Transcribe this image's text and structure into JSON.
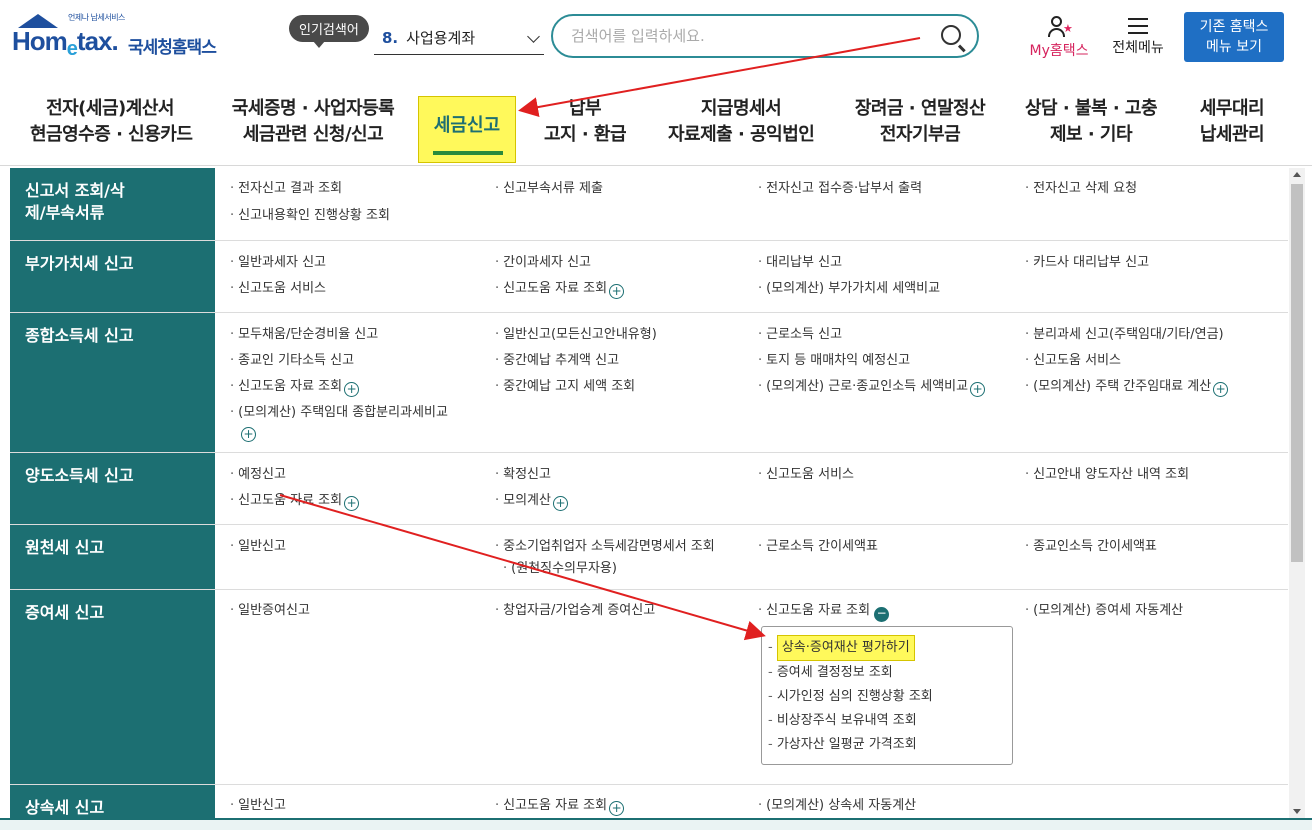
{
  "logo": {
    "tagline": "언제나 납세서비스",
    "brand_home": "Hom",
    "brand_e": "e",
    "brand_tax": "tax.",
    "korean_name": "국세청홈택스"
  },
  "popular": {
    "badge": "인기검색어",
    "rank": "8.",
    "keyword": "사업용계좌"
  },
  "search": {
    "placeholder": "검색어를 입력하세요."
  },
  "utility": {
    "my_hometax": "My홈택스",
    "all_menu": "전체메뉴",
    "old_menu_line1": "기존 홈택스",
    "old_menu_line2": "메뉴 보기"
  },
  "gnb": {
    "items": [
      {
        "line1": "전자(세금)계산서",
        "line2": "현금영수증 · 신용카드"
      },
      {
        "line1": "국세증명 · 사업자등록",
        "line2": "세금관련 신청/신고"
      },
      {
        "line1": "세금신고",
        "line2": ""
      },
      {
        "line1": "납부",
        "line2": "고지 · 환급"
      },
      {
        "line1": "지급명세서",
        "line2": "자료제출 · 공익법인"
      },
      {
        "line1": "장려금 · 연말정산",
        "line2": "전자기부금"
      },
      {
        "line1": "상담 · 불복 · 고충",
        "line2": "제보 · 기타"
      },
      {
        "line1": "세무대리",
        "line2": "납세관리"
      }
    ]
  },
  "rows": [
    {
      "category": "신고서 조회/삭제/부속서류",
      "links": [
        "전자신고 결과 조회",
        "신고부속서류 제출",
        "전자신고 접수증·납부서 출력",
        "전자신고 삭제 요청",
        "신고내용확인 진행상황 조회"
      ]
    },
    {
      "category": "부가가치세 신고",
      "links": [
        "일반과세자 신고",
        "간이과세자 신고",
        "대리납부 신고",
        "카드사 대리납부 신고",
        "신고도움 서비스",
        "신고도움 자료 조회",
        "(모의계산) 부가가치세 세액비교"
      ]
    },
    {
      "category": "종합소득세 신고",
      "links": [
        "모두채움/단순경비율 신고",
        "일반신고(모든신고안내유형)",
        "근로소득 신고",
        "분리과세 신고(주택임대/기타/연금)",
        "종교인 기타소득 신고",
        "중간예납 추계액 신고",
        "토지 등 매매차익 예정신고",
        "신고도움 서비스",
        "신고도움 자료 조회",
        "중간예납 고지 세액 조회",
        "(모의계산) 근로·종교인소득 세액비교",
        "(모의계산) 주택 간주임대료 계산",
        "(모의계산) 주택임대 종합분리과세비교"
      ]
    },
    {
      "category": "양도소득세 신고",
      "links": [
        "예정신고",
        "확정신고",
        "신고도움 서비스",
        "신고안내 양도자산 내역 조회",
        "신고도움 자료 조회",
        "모의계산"
      ]
    },
    {
      "category": "원천세 신고",
      "links": [
        "일반신고",
        "중소기업취업자 소득세감면명세서 조회",
        "(원천징수의무자용)",
        "근로소득 간이세액표",
        "종교인소득 간이세액표"
      ]
    },
    {
      "category": "증여세 신고",
      "links": [
        "일반증여신고",
        "창업자금/가업승계 증여신고",
        "신고도움 자료 조회",
        "(모의계산) 증여세 자동계산"
      ]
    },
    {
      "category": "상속세 신고",
      "links": [
        "일반신고",
        "신고도움 자료 조회",
        "(모의계산) 상속세 자동계산"
      ]
    }
  ],
  "submenu": {
    "items": [
      "상속·증여재산 평가하기",
      "증여세 결정정보 조회",
      "시가인정 심의 진행상황 조회",
      "비상장주식 보유내역 조회",
      "가상자산 일평균 가격조회"
    ]
  },
  "symbols": {
    "plus": "+",
    "minus": "−"
  },
  "colors": {
    "teal": "#1c6f72",
    "brand_blue": "#1e4f9e",
    "highlight": "#fff95b",
    "arrow": "#e02020"
  }
}
